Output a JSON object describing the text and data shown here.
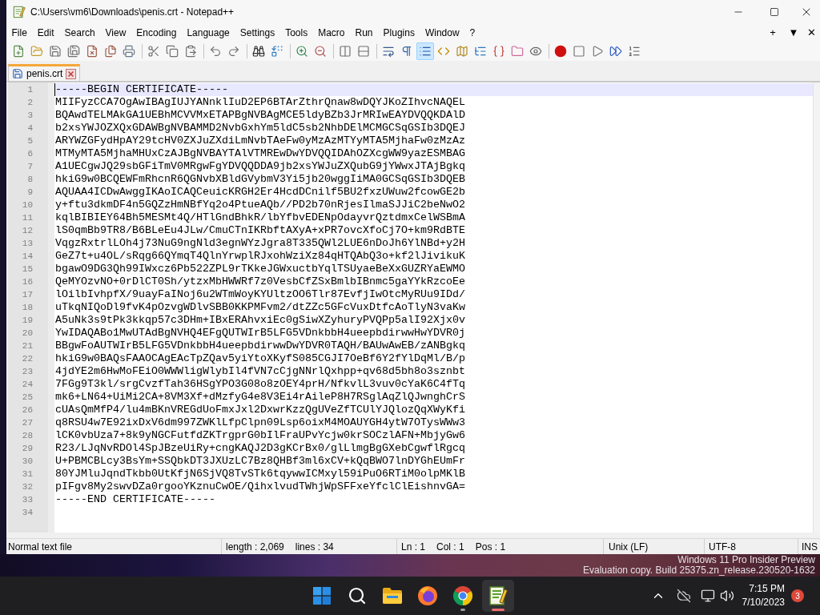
{
  "window": {
    "title": "C:\\Users\\vm6\\Downloads\\penis.crt - Notepad++"
  },
  "menu_bar": {
    "items": [
      "File",
      "Edit",
      "Search",
      "View",
      "Encoding",
      "Language",
      "Settings",
      "Tools",
      "Macro",
      "Run",
      "Plugins",
      "Window",
      "?"
    ],
    "tab_controls": [
      "+",
      "▼",
      "✕"
    ]
  },
  "toolbar": {
    "groups": [
      {
        "buttons": [
          {
            "kind": "new",
            "pressed": false
          },
          {
            "kind": "open",
            "pressed": false
          },
          {
            "kind": "save",
            "pressed": false
          },
          {
            "kind": "saveall",
            "pressed": false
          },
          {
            "kind": "close",
            "pressed": false
          },
          {
            "kind": "closeall",
            "pressed": false
          },
          {
            "kind": "print",
            "pressed": false
          }
        ]
      },
      {
        "buttons": [
          {
            "kind": "cut",
            "pressed": false
          },
          {
            "kind": "copy",
            "pressed": false
          },
          {
            "kind": "paste",
            "pressed": false
          }
        ]
      },
      {
        "buttons": [
          {
            "kind": "undo",
            "pressed": false
          },
          {
            "kind": "redo",
            "pressed": false
          }
        ]
      },
      {
        "buttons": [
          {
            "kind": "find",
            "pressed": false
          },
          {
            "kind": "replace",
            "pressed": false
          }
        ]
      },
      {
        "buttons": [
          {
            "kind": "zoomin",
            "pressed": false
          },
          {
            "kind": "zoomout",
            "pressed": false
          }
        ]
      },
      {
        "buttons": [
          {
            "kind": "syncv",
            "pressed": false
          },
          {
            "kind": "synch",
            "pressed": false
          }
        ]
      },
      {
        "buttons": [
          {
            "kind": "wrap",
            "pressed": false
          },
          {
            "kind": "symbols",
            "pressed": false
          },
          {
            "kind": "indentguide",
            "pressed": true
          },
          {
            "kind": "udl",
            "pressed": false
          },
          {
            "kind": "docmap",
            "pressed": false
          },
          {
            "kind": "doclist",
            "pressed": false
          },
          {
            "kind": "functionlist",
            "pressed": false
          },
          {
            "kind": "workspace",
            "pressed": false
          },
          {
            "kind": "monitor",
            "pressed": false
          }
        ]
      },
      {
        "buttons": [
          {
            "kind": "record",
            "pressed": false
          },
          {
            "kind": "stop",
            "pressed": false
          },
          {
            "kind": "play",
            "pressed": false
          },
          {
            "kind": "playmulti",
            "pressed": false
          },
          {
            "kind": "savemacro",
            "pressed": false
          }
        ]
      }
    ]
  },
  "tabs": [
    {
      "label": "penis.crt",
      "selected": true,
      "modified": false
    }
  ],
  "editor": {
    "lines": [
      {
        "number": "1",
        "text": "-----BEGIN CERTIFICATE-----",
        "current": true
      },
      {
        "number": "2",
        "text": "MIIFyzCCA7OgAwIBAgIUJYANnklIuD2EP6BTArZthrQnaw8wDQYJKoZIhvcNAQEL",
        "current": false
      },
      {
        "number": "3",
        "text": "BQAwdTELMAkGA1UEBhMCVVMxETAPBgNVBAgMCE5ldyBZb3JrMRIwEAYDVQQKDAlD",
        "current": false
      },
      {
        "number": "4",
        "text": "b2xsYWJOZXQxGDAWBgNVBAMMD2NvbGxhYm5ldC5sb2NhbDElMCMGCSqGSIb3DQEJ",
        "current": false
      },
      {
        "number": "5",
        "text": "ARYWZGFydHpAY29tcHV0ZXJuZXdiLmNvbTAeFw0yMzAzMTYyMTA5MjhaFw0zMzAz",
        "current": false
      },
      {
        "number": "6",
        "text": "MTMyMTA5MjhaMHUxCzAJBgNVBAYTAlVTMREwDwYDVQQIDAhOZXcgWW9yazESMBAG",
        "current": false
      },
      {
        "number": "7",
        "text": "A1UECgwJQ29sbGFiTmV0MRgwFgYDVQQDDA9jb2xsYWJuZXQubG9jYWwxJTAjBgkq",
        "current": false
      },
      {
        "number": "8",
        "text": "hkiG9w0BCQEWFmRhcnR6QGNvbXBldGVybmV3Yi5jb20wggIiMA0GCSqGSIb3DQEB",
        "current": false
      },
      {
        "number": "9",
        "text": "AQUAA4ICDwAwggIKAoICAQCeuicKRGH2Er4HcdDCnilf5BU2fxzUWuw2fcowGE2b",
        "current": false
      },
      {
        "number": "10",
        "text": "y+ftu3dkmDF4n5GQZzHmNBfYq2o4PtueAQb//PD2b70nRjesIlmaSJJiC2beNwO2",
        "current": false
      },
      {
        "number": "11",
        "text": "kqlBIBIEY64Bh5MESMt4Q/HTlGndBhkR/lbYfbvEDENpOdayvrQztdmxCelWSBmA",
        "current": false
      },
      {
        "number": "12",
        "text": "lS0qmBb9TR8/B6BLeEu4JLw/CmuCTnIKRbftAXyA+xPR7ovcXfoCj7O+km9RdBTE",
        "current": false
      },
      {
        "number": "13",
        "text": "VqgzRxtrlLOh4j73NuG9ngNld3egnWYzJgra8T335QWl2LUE6nDoJh6YlNBd+y2H",
        "current": false
      },
      {
        "number": "14",
        "text": "GeZ7t+u4OL/sRqg66QYmqT4QlnYrwplRJxohWziXz84qHTQAbQ3o+kf2lJivikuK",
        "current": false
      },
      {
        "number": "15",
        "text": "bgawO9DG3Qh99IWxcz6Pb522ZPL9rTKkeJGWxuctbYqlTSUyaeBeXxGUZRYaEWMO",
        "current": false
      },
      {
        "number": "16",
        "text": "QeMYOzvNO+0rDlCT0Sh/ytzxMbHWWRf7z0VesbCfZSxBmlbIBnmc5gaYYkRzcoEe",
        "current": false
      },
      {
        "number": "17",
        "text": "lOilbIvhpfX/9uayFaINoj6u2WTmWoyKYUltzOO6Tlr87EvfjIwOtcMyRUu9IDd/",
        "current": false
      },
      {
        "number": "18",
        "text": "uTkqNIQoDl9fvK4pOzvgWDlvSBB0KKPMFvm2/dtZZc5GFcVuxDtfcAoTlyN3vaKw",
        "current": false
      },
      {
        "number": "19",
        "text": "A5uNk3s9tPk3kkqp57c3DHm+IBxERAhvxiEc0gSiwXZyhuryPVQPp5alI92Xjx0v",
        "current": false
      },
      {
        "number": "20",
        "text": "YwIDAQABo1MwUTAdBgNVHQ4EFgQUTWIrB5LFG5VDnkbbH4ueepbdirwwHwYDVR0j",
        "current": false
      },
      {
        "number": "21",
        "text": "BBgwFoAUTWIrB5LFG5VDnkbbH4ueepbdirwwDwYDVR0TAQH/BAUwAwEB/zANBgkq",
        "current": false
      },
      {
        "number": "22",
        "text": "hkiG9w0BAQsFAAOCAgEAcTpZQav5yiYtoXKyfS085CGJI7OeBf6Y2fYlDqMl/B/p",
        "current": false
      },
      {
        "number": "23",
        "text": "4jdYE2m6HwMoFEiO0WWWligWlybIl4fVN7cCjgNNrlQxhpp+qv68d5bh8o3sznbt",
        "current": false
      },
      {
        "number": "24",
        "text": "7FGg9T3kl/srgCvzfTah36HSgYPO3G08o8zOEY4prH/NfkvlL3vuv0cYaK6C4fTq",
        "current": false
      },
      {
        "number": "25",
        "text": "mk6+LN64+UiMi2CA+8VM3Xf+dMzfyG4e8V3Ei4rAileP8H7RSglAqZlQJwnghCrS",
        "current": false
      },
      {
        "number": "26",
        "text": "cUAsQmMfP4/lu4mBKnVREGdUoFmxJxl2DxwrKzzQgUVeZfTCUlYJQlozQqXWyKfi",
        "current": false
      },
      {
        "number": "27",
        "text": "q8RSU4w7E92ixDxV6dm997ZWKlLfpClpn09Lsp6oixM4MOAUYGH4ytW7OTysWWw3",
        "current": false
      },
      {
        "number": "28",
        "text": "lCK0vbUza7+8k9yNGCFutfdZKTrgprG0bIlFraUPvYcjw0krSOCzlAFN+MbjyGw6",
        "current": false
      },
      {
        "number": "29",
        "text": "R23/LJqNvRDOl4SpJBzeUiRy+cngKAQJ2D3gKCrBx0/glLlmgBgGXebCgwflRgcq",
        "current": false
      },
      {
        "number": "30",
        "text": "U+PBMCBLcy3BsYm+SSQbkDT3JXUzLC7Bz8QHBf3ml6xCV+kQqBWO7lnDYGhEUmFr",
        "current": false
      },
      {
        "number": "31",
        "text": "80YJMluJqndTkbb0UtKfjN6SjVQ8TvSTk6tqywwICMxyl59iPuO6RTiM0olpMKlB",
        "current": false
      },
      {
        "number": "32",
        "text": "pIFgv8My2swvDZa0rgooYKznuCwOE/QihxlvudTWhjWpSFFxeYfclClEishnvGA=",
        "current": false
      },
      {
        "number": "33",
        "text": "-----END CERTIFICATE-----",
        "current": false
      },
      {
        "number": "34",
        "current": false
      }
    ]
  },
  "status_bar": {
    "file_type": "Normal text file",
    "length": "length : 2,069",
    "lines": "lines : 34",
    "line": "Ln : 1",
    "column": "Col : 1",
    "position": "Pos : 1",
    "line_ending": "Unix (LF)",
    "encoding": "UTF-8",
    "mode": "INS"
  },
  "desktop": {
    "notice": [
      "Windows 11 Pro Insider Preview",
      "Evaluation copy. Build 25375.zn_release.230520-1632"
    ]
  },
  "taskbar": {
    "apps": [
      {
        "kind": "start",
        "running": false,
        "active": false
      },
      {
        "kind": "search",
        "running": false,
        "active": false
      },
      {
        "kind": "files",
        "running": false,
        "active": false
      },
      {
        "kind": "firefox",
        "running": false,
        "active": false
      },
      {
        "kind": "chrome",
        "running": true,
        "active": false
      },
      {
        "kind": "notepad",
        "running": true,
        "active": true
      }
    ],
    "tray": {
      "time": "7:15 PM",
      "date": "7/10/2023",
      "notifications": "3"
    }
  }
}
